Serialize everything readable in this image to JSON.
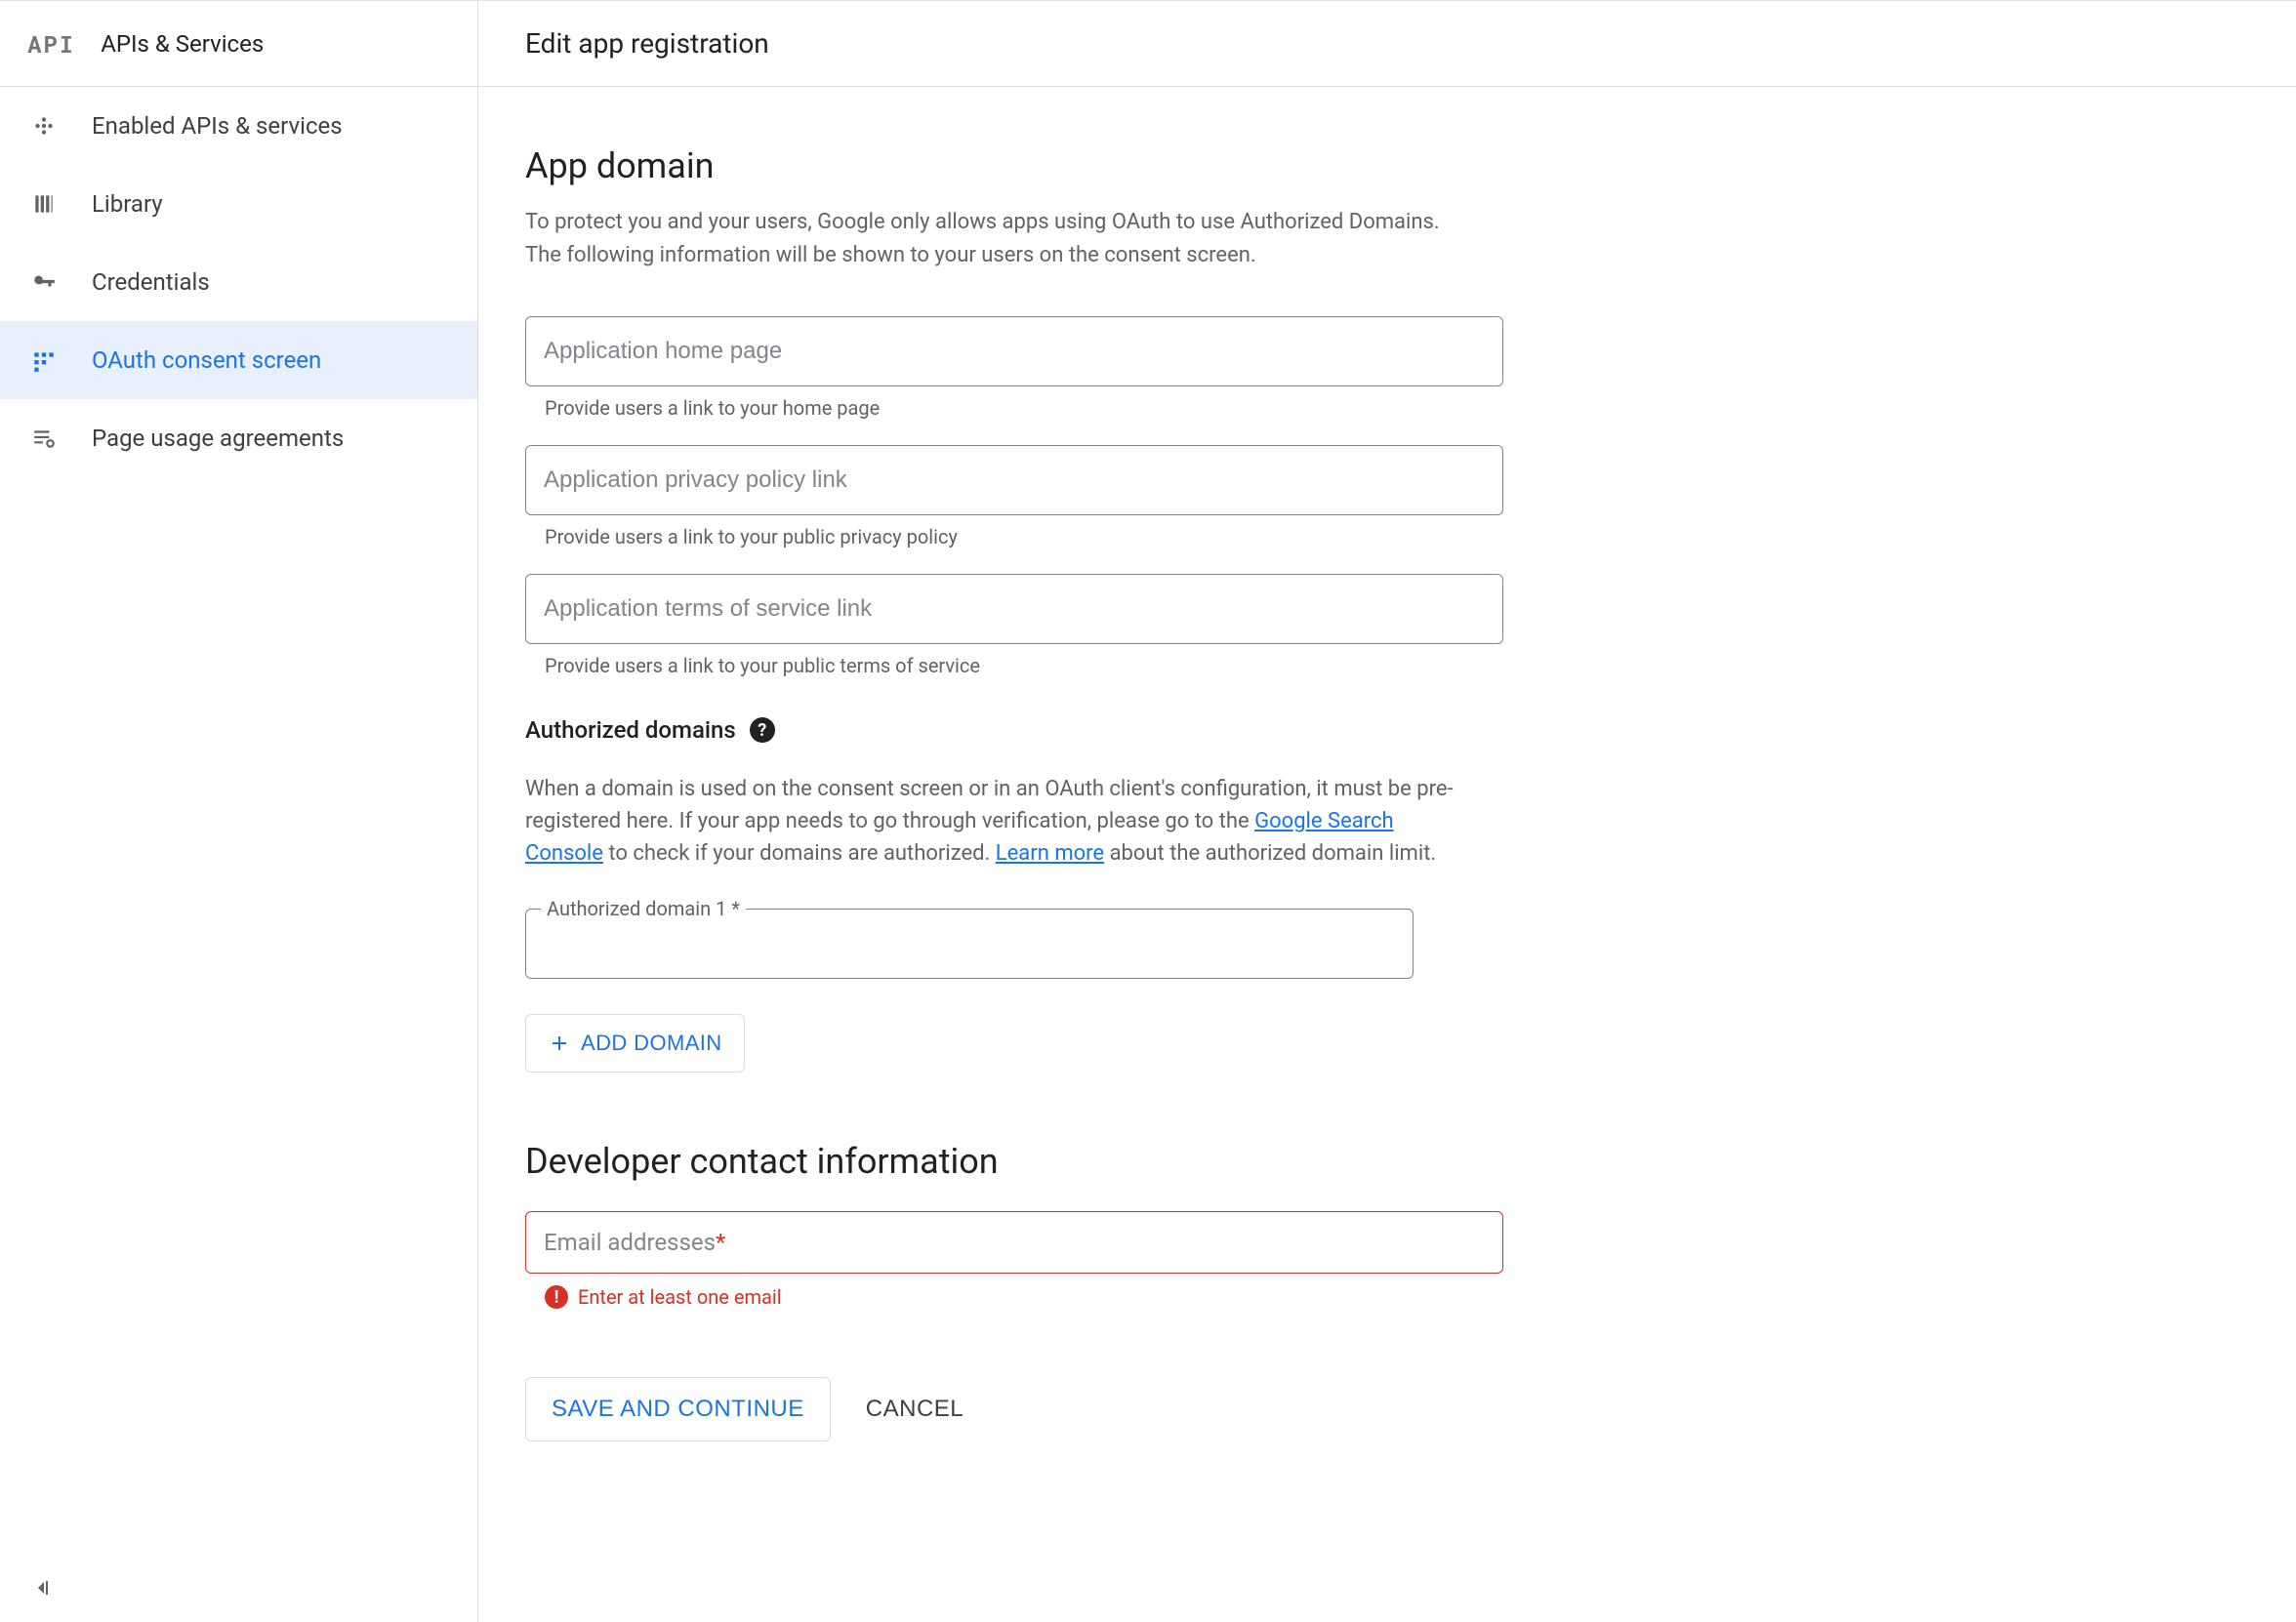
{
  "sidebar": {
    "logo": "API",
    "title": "APIs & Services",
    "items": [
      {
        "label": "Enabled APIs & services"
      },
      {
        "label": "Library"
      },
      {
        "label": "Credentials"
      },
      {
        "label": "OAuth consent screen"
      },
      {
        "label": "Page usage agreements"
      }
    ]
  },
  "header": {
    "title": "Edit app registration"
  },
  "app_domain": {
    "heading": "App domain",
    "description": "To protect you and your users, Google only allows apps using OAuth to use Authorized Domains. The following information will be shown to your users on the consent screen.",
    "home": {
      "placeholder": "Application home page",
      "helper": "Provide users a link to your home page"
    },
    "privacy": {
      "placeholder": "Application privacy policy link",
      "helper": "Provide users a link to your public privacy policy"
    },
    "tos": {
      "placeholder": "Application terms of service link",
      "helper": "Provide users a link to your public terms of service"
    }
  },
  "authorized_domains": {
    "heading": "Authorized domains",
    "para_before_link1": "When a domain is used on the consent screen or in an OAuth client's configuration, it must be pre-registered here. If your app needs to go through verification, please go to the ",
    "link1": "Google Search Console",
    "para_mid": " to check if your domains are authorized. ",
    "link2": "Learn more",
    "para_after_link2": " about the authorized domain limit.",
    "field_label": "Authorized domain 1 *",
    "add_button": "ADD DOMAIN"
  },
  "developer_contact": {
    "heading": "Developer contact information",
    "email_label": "Email addresses ",
    "email_star": "*",
    "error_text": "Enter at least one email"
  },
  "actions": {
    "save": "SAVE AND CONTINUE",
    "cancel": "CANCEL"
  }
}
